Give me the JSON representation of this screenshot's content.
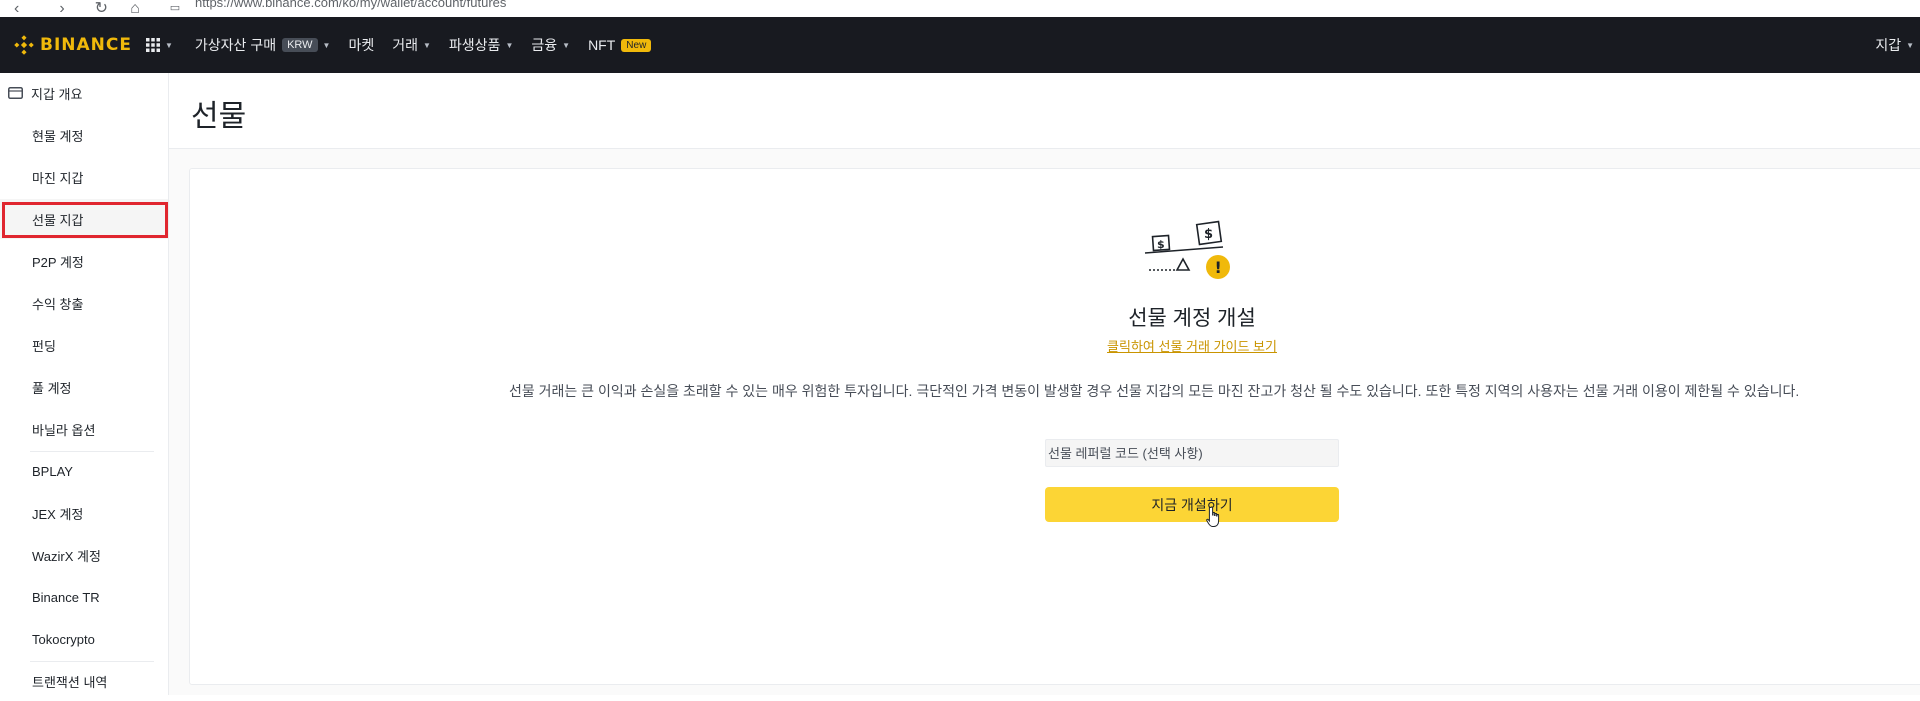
{
  "browser": {
    "url": "https://www.binance.com/ko/my/wallet/account/futures"
  },
  "topnav": {
    "brand": "BINANCE",
    "items": [
      {
        "label": "가상자산 구매",
        "badge": "KRW",
        "dropdown": true
      },
      {
        "label": "마켓",
        "dropdown": false
      },
      {
        "label": "거래",
        "dropdown": true
      },
      {
        "label": "파생상품",
        "dropdown": true
      },
      {
        "label": "금융",
        "dropdown": true
      },
      {
        "label": "NFT",
        "badge": "New",
        "dropdown": false
      }
    ],
    "right_label": "지갑"
  },
  "sidebar": {
    "items": [
      {
        "label": "지갑 개요"
      },
      {
        "label": "현물 계정"
      },
      {
        "label": "마진 지갑"
      },
      {
        "label": "선물 지갑",
        "active": true
      },
      {
        "label": "P2P 계정"
      },
      {
        "label": "수익 창출"
      },
      {
        "label": "펀딩"
      },
      {
        "label": "풀 계정"
      },
      {
        "label": "바닐라 옵션"
      },
      {
        "label": "BPLAY"
      },
      {
        "label": "JEX 계정"
      },
      {
        "label": "WazirX 계정"
      },
      {
        "label": "Binance TR"
      },
      {
        "label": "Tokocrypto"
      },
      {
        "label": "트랜잭션 내역"
      }
    ]
  },
  "main": {
    "page_title": "선물",
    "card": {
      "heading": "선물 계정 개설",
      "guide_link": "클릭하여 선물 거래 가이드 보기",
      "warning": "선물 거래는 큰 이익과 손실을 초래할 수 있는 매우 위험한 투자입니다. 극단적인 가격 변동이 발생할 경우 선물 지갑의 모든 마진 잔고가 청산 될 수도 있습니다. 또한 특정 지역의 사용자는 선물 거래 이용이 제한될 수 있습니다.",
      "referral_placeholder": "선물 레퍼럴 코드 (선택 사항)",
      "open_button": "지금 개설하기"
    }
  },
  "colors": {
    "brand_yellow": "#f0b90b",
    "button_yellow": "#fcd535",
    "nav_bg": "#181a20",
    "link": "#c99400",
    "highlight_outline": "#e0262f"
  }
}
